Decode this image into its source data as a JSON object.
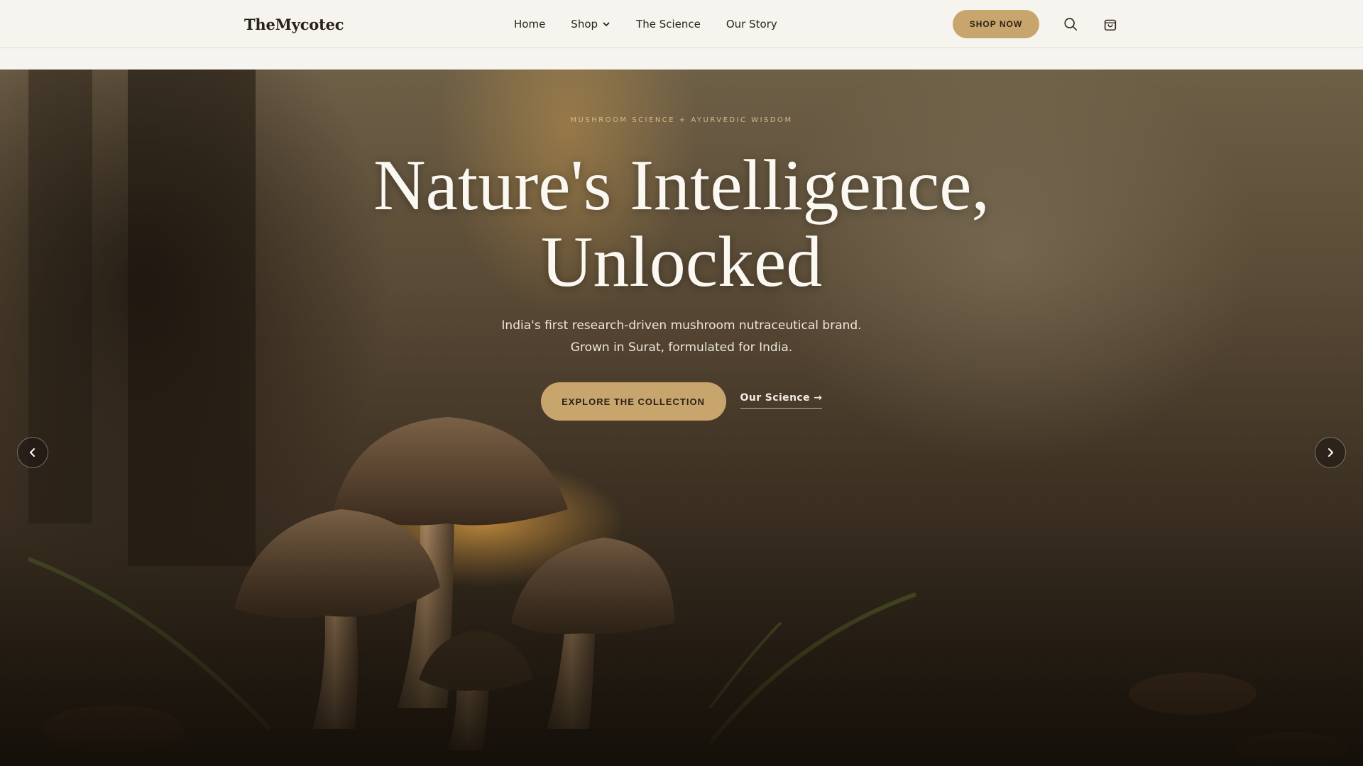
{
  "header": {
    "logo": "TheMycotec",
    "nav": [
      {
        "label": "Home"
      },
      {
        "label": "Shop"
      },
      {
        "label": "The Science"
      },
      {
        "label": "Our Story"
      }
    ],
    "cta": "SHOP NOW",
    "icons": [
      "search-icon",
      "shopping-bag-icon"
    ]
  },
  "hero": {
    "eyebrow": "MUSHROOM SCIENCE + AYURVEDIC WISDOM",
    "title_line1": "Nature's Intelligence,",
    "title_line2": "Unlocked",
    "sub_line1": "India's first research-driven mushroom nutraceutical brand.",
    "sub_line2": "Grown in Surat, formulated for India.",
    "primary_cta": "EXPLORE THE COLLECTION",
    "secondary_cta": "Our Science →",
    "controls": [
      "chevron-left-icon",
      "chevron-right-icon"
    ]
  },
  "colors": {
    "accent": "#c9a56e",
    "header_bg": "#f6f4ef",
    "text_dark": "#2a2118"
  }
}
